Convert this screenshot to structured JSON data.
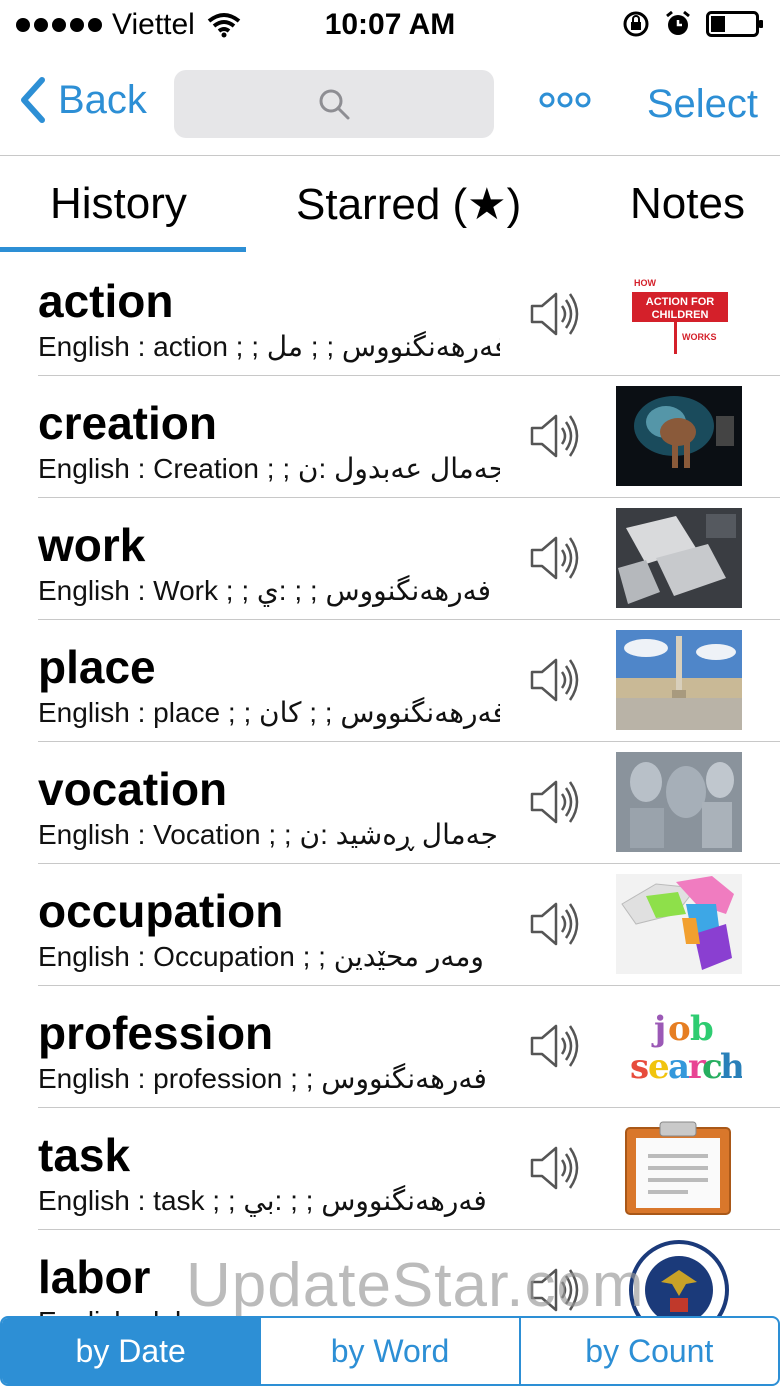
{
  "status_bar": {
    "carrier": "Viettel",
    "time": "10:07 AM"
  },
  "nav": {
    "back_label": "Back",
    "search_placeholder": "",
    "select_label": "Select"
  },
  "tabs": [
    {
      "label": "History",
      "active": true
    },
    {
      "label": "Starred (★)",
      "active": false
    },
    {
      "label": "Notes",
      "active": false
    }
  ],
  "entries": [
    {
      "word": "action",
      "desc": "English : action ; ; فەرهەنگنووس ; ; مل",
      "thumb": "action-for-children-logo"
    },
    {
      "word": "creation",
      "desc": "English : Creation ; ; جەمال عەبدول :ن",
      "thumb": "creation-art-image"
    },
    {
      "word": "work",
      "desc": "English : Work ; ; فەرهەنگنووس ; ; :ي",
      "thumb": "work-papers-image"
    },
    {
      "word": "place",
      "desc": "English : place ; ; فەرهەنگنووس ; ; كان",
      "thumb": "place-square-image"
    },
    {
      "word": "vocation",
      "desc": "English : Vocation ; ; جەمال ڕەشید :ن",
      "thumb": "vocation-sculpture-image"
    },
    {
      "word": "occupation",
      "desc": "English : Occupation ; ; ومەر محێدین",
      "thumb": "occupation-map-image"
    },
    {
      "word": "profession",
      "desc": "English : profession ; ; فەرهەنگنووس",
      "thumb": "job-search-image"
    },
    {
      "word": "task",
      "desc": "English : task ; ; فەرهەنگنووس ; ; :بي",
      "thumb": "clipboard-image"
    },
    {
      "word": "labor",
      "desc": "English : labor",
      "thumb": "department-of-labor-seal"
    }
  ],
  "watermark": "UpdateStar.com",
  "sort": [
    {
      "label": "by Date",
      "active": true
    },
    {
      "label": "by Word",
      "active": false
    },
    {
      "label": "by Count",
      "active": false
    }
  ],
  "colors": {
    "accent": "#2d8fd5",
    "separator": "#c8c8c8"
  }
}
